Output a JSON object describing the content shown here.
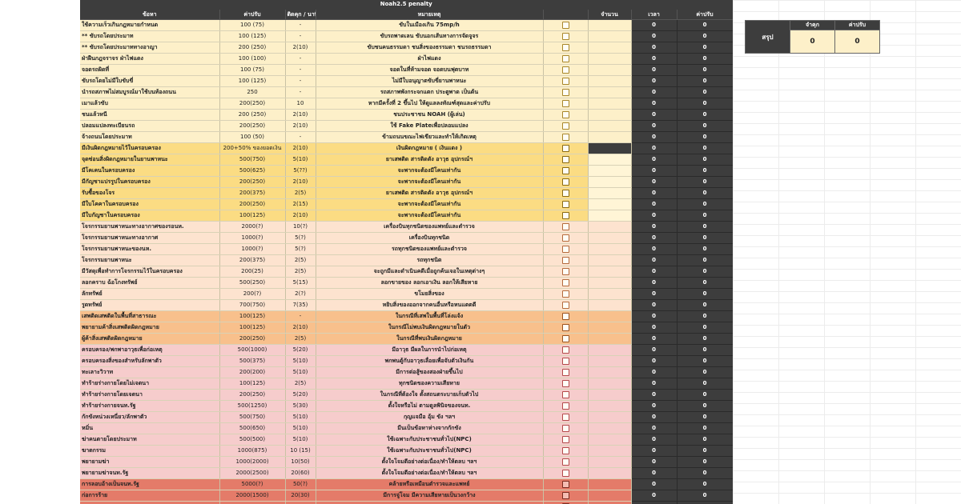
{
  "sheet_title": "Noah2.5 penalty",
  "headers": {
    "name": "ข้อหา",
    "fine": "ค่าปรับ",
    "jail": "ติดคุก / นาที",
    "note": "หมายเหตุ",
    "check": "",
    "count": "จำนวน",
    "time": "เวลา",
    "sum": "ค่าปรับ"
  },
  "rows": [
    {
      "g": "g1",
      "name": "ใช้ความเร็วเกินกฎหมายกำหนด",
      "fine": "100 (75)",
      "jail": "-",
      "note": "ขับในเมืองเกิน 75mp/h",
      "time": "0",
      "sum": "0"
    },
    {
      "g": "g1",
      "name": "** ขับรถโดยประมาท",
      "fine": "100 (125)",
      "jail": "-",
      "note": "ขับรถพาดเลน ขับนอกเส้นทางการจัดจูจร",
      "time": "0",
      "sum": "0"
    },
    {
      "g": "g1",
      "name": "** ขับรถโดยประมาททางอาญา",
      "fine": "200 (250)",
      "jail": "2(10)",
      "note": "ขับชนคนธรรมดา ชนสิ่งของธรรมดา ชนรถธรรมดา",
      "time": "0",
      "sum": "0"
    },
    {
      "g": "g1",
      "name": "ฝ่าฝืนกฎจราจร ฝ่าไฟแดง",
      "fine": "100 (100)",
      "jail": "-",
      "note": "ฝ่าไฟแดง",
      "time": "0",
      "sum": "0"
    },
    {
      "g": "g1",
      "name": "จอดรถผิดที่",
      "fine": "100 (75)",
      "jail": "-",
      "note": "จอดในที่ห้ามจอด จอดบนฟุตบาท",
      "time": "0",
      "sum": "0"
    },
    {
      "g": "g1",
      "name": "ขับรถโดยไม่มีใบขับขี่",
      "fine": "100 (125)",
      "jail": "-",
      "note": "ไม่มีใบอนุญาตขับขี่ยานพาหนะ",
      "time": "0",
      "sum": "0"
    },
    {
      "g": "g1",
      "name": "นำรถสภาพไม่สมบูรณ์มาใช้บนท้องถนน",
      "fine": "250",
      "jail": "-",
      "note": "รถสภาพพังกระจกแตก ประตูพาด เป็นต้น",
      "time": "0",
      "sum": "0"
    },
    {
      "g": "g1",
      "name": "เมาแล้วขับ",
      "fine": "200(250)",
      "jail": "10",
      "note": "หากมีครั้งที่ 2 ขึ้นไป ให้ดูแลลงทัณฑ์สุดและค่าปรับ",
      "time": "0",
      "sum": "0"
    },
    {
      "g": "g1",
      "name": "ชนแล้วหนี",
      "fine": "200 (250)",
      "jail": "2(10)",
      "note": "ชนประชาชน NOAH (ผู้เล่น)",
      "time": "0",
      "sum": "0"
    },
    {
      "g": "g1",
      "name": "ปลอมแปลงทะเบียนรถ",
      "fine": "200(250)",
      "jail": "2(10)",
      "note": "ใช้ Fake Plateเพื่อปลอมแปลง",
      "time": "0",
      "sum": "0"
    },
    {
      "g": "g1",
      "name": "จ้างถนนโดยประมาท",
      "fine": "100 (50)",
      "jail": "-",
      "note": "ข้ามถนนขณะไฟเขียวและทำให้เกิดเหตุ",
      "time": "0",
      "sum": "0"
    },
    {
      "g": "g2",
      "name": "มีเงินผิดกฎหมายไว้ในครอบครอง",
      "fine": "200+50% ของยอดเงิน",
      "jail": "2(10)",
      "note": "เงินผิดกฎหมาย ( เงินแดง )",
      "time": "0",
      "sum": "0",
      "dark": true
    },
    {
      "g": "g2",
      "name": "จุดซ่อนสิ่งผิดกฎหมายในยานพาหนะ",
      "fine": "500(750)",
      "jail": "5(10)",
      "note": "ยาเสพติด สารติดตัง อาวุธ อุปกรณ์ฯ",
      "time": "0",
      "sum": "0"
    },
    {
      "g": "g2",
      "name": "มีโคเคนในครอบครอง",
      "fine": "500(625)",
      "jail": "5(??)",
      "note": "จะพากจะต้องมีโคนเท่ากัน",
      "time": "0",
      "sum": "0"
    },
    {
      "g": "g2",
      "name": "มีกัญชาแปรรูปในครอบครอง",
      "fine": "200(250)",
      "jail": "2(10)",
      "note": "จะพากจะต้องมีโคนเท่ากัน",
      "time": "0",
      "sum": "0"
    },
    {
      "g": "g2",
      "name": "รับซื้อของโจร",
      "fine": "200(375)",
      "jail": "2(5)",
      "note": "ยาเสพติด สารติดตัง อาวุธ อุปกรณ์ฯ",
      "time": "0",
      "sum": "0"
    },
    {
      "g": "g2",
      "name": "มีใบโคคาในครอบครอง",
      "fine": "200(250)",
      "jail": "2(15)",
      "note": "จะพากจะต้องมีโคนเท่ากัน",
      "time": "0",
      "sum": "0"
    },
    {
      "g": "g2",
      "name": "มีใบกัญชาในครอบครอง",
      "fine": "100(125)",
      "jail": "2(10)",
      "note": "จะพากจะต้องมีโคนเท่ากัน",
      "time": "0",
      "sum": "0"
    },
    {
      "g": "g3",
      "name": "โจรกรรมยานพาหนะทางอากาศของรอนห.",
      "fine": "2000(?)",
      "jail": "10(?)",
      "note": "เครื่องบินทุกชนิดของแพทย์และตำรวจ",
      "time": "0",
      "sum": "0"
    },
    {
      "g": "g3",
      "name": "โจรกรรมยานพาหนะทางอากาศ",
      "fine": "1000(?)",
      "jail": "5(?)",
      "note": "เครื่องบินทุกชนิด",
      "time": "0",
      "sum": "0"
    },
    {
      "g": "g3",
      "name": "โจรกรรมยานพาหนะของนห.",
      "fine": "1000(?)",
      "jail": "5(?)",
      "note": "รถทุกชนิดของแพทย์และตำรวจ",
      "time": "0",
      "sum": "0"
    },
    {
      "g": "g3",
      "name": "โจรกรรมยานพาหนะ",
      "fine": "200(375)",
      "jail": "2(5)",
      "note": "รถทุกชนิด",
      "time": "0",
      "sum": "0"
    },
    {
      "g": "g3",
      "name": "มีวัสดุเพื่อทำการโจรกรรมไว้ในครอบครอง",
      "fine": "200(25)",
      "jail": "2(5)",
      "note": "จะถูกมีและดำเนินคดีเมื่อถูกค้นเจอในเหตุต่างๆ",
      "time": "0",
      "sum": "0"
    },
    {
      "g": "g3",
      "name": "ลอกคราบ ฉ้อโกงทรัพย์",
      "fine": "500(250)",
      "jail": "5(15)",
      "note": "ลอกขายของ ลอกเอาเงิน ลอกให้เสียหาย",
      "time": "0",
      "sum": "0"
    },
    {
      "g": "g3",
      "name": "ลักทรัพย์",
      "fine": "200(?)",
      "jail": "2(?)",
      "note": "ขโมยสิ่งของ",
      "time": "0",
      "sum": "0"
    },
    {
      "g": "g3",
      "name": "รูดทรัพย์",
      "fine": "700(750)",
      "jail": "7(35)",
      "note": "หยิบสิ่งของออกจากคนอื่นหรือหนแตตดี",
      "time": "0",
      "sum": "0"
    },
    {
      "g": "g4",
      "name": "เสพติดเสพติดในพื้นที่สาธารณะ",
      "fine": "100(125)",
      "jail": "-",
      "note": "ในกรณีที่เสพในพื้นที่โล่งแจ้ง",
      "time": "0",
      "sum": "0"
    },
    {
      "g": "g4",
      "name": "พยายามค้าสิ่งเสพติดผิดกฎหมาย",
      "fine": "100(125)",
      "jail": "2(10)",
      "note": "ในกรณีไม่พบเงินผิดกฎหมายในตัว",
      "time": "0",
      "sum": "0"
    },
    {
      "g": "g4",
      "name": "ผู้ค้าสิ่งเสพติดผิดกฎหมาย",
      "fine": "200(250)",
      "jail": "2(5)",
      "note": "ในกรณีที่พบเงินผิดกฎหมาย",
      "time": "0",
      "sum": "0"
    },
    {
      "g": "g5",
      "name": "ครอบครอง/พกพาอาวุธเพื่อก่อเหตุ",
      "fine": "500(1000)",
      "jail": "5(20)",
      "note": "มีอาวุธ มีผลในการนำไปก่อเหตุ",
      "time": "0",
      "sum": "0"
    },
    {
      "g": "g5",
      "name": "ครอบครองสิ่งของสำหรับลักพาตัว",
      "fine": "500(375)",
      "jail": "5(10)",
      "note": "พกพนตู้กับอาวุธเลื่อยเพื่อจับตัวเงินกัน",
      "time": "0",
      "sum": "0"
    },
    {
      "g": "g5",
      "name": "ทะเลาะวิวาท",
      "fine": "200(200)",
      "jail": "5(10)",
      "note": "มีการต่อสู้ของสองฝ่ายขึ้นไป",
      "time": "0",
      "sum": "0"
    },
    {
      "g": "g5",
      "name": "ทำร้ายร่างกายโดยไม่เจตนา",
      "fine": "100(125)",
      "jail": "2(5)",
      "note": "ทุกชนิดของความเสียหาย",
      "time": "0",
      "sum": "0"
    },
    {
      "g": "g5",
      "name": "ทำร้ายร่างกายโดยเจตนา",
      "fine": "200(250)",
      "jail": "5(20)",
      "note": "ในกรณีที่ต้องใจ ตั้งสถนตระบายเก็บตัวไป",
      "time": "0",
      "sum": "0"
    },
    {
      "g": "g5",
      "name": "ทำร้ายร่างกายจนท.รัฐ",
      "fine": "500(1250)",
      "jail": "5(30)",
      "note": "ตั้งใจหรือไม่ ตามดูลพินิจของจนท.",
      "time": "0",
      "sum": "0"
    },
    {
      "g": "g5",
      "name": "กักขังหน่วงเหนี่ยว/ลักพาตัว",
      "fine": "500(750)",
      "jail": "5(10)",
      "note": "กุญแจมือ อุ้ม ขัง ฯลฯ",
      "time": "0",
      "sum": "0"
    },
    {
      "g": "g5",
      "name": "หมิ่น",
      "fine": "500(650)",
      "jail": "5(10)",
      "note": "มีนเป็นข้อหาห่างจากกักขัง",
      "time": "0",
      "sum": "0"
    },
    {
      "g": "g5",
      "name": "ฆ่าคนตายโดยประมาท",
      "fine": "500(500)",
      "jail": "5(10)",
      "note": "ใช้เฉพาะกับประชาชนทั่วไป(NPC)",
      "time": "0",
      "sum": "0"
    },
    {
      "g": "g5",
      "name": "ฆาตกรรม",
      "fine": "1000(875)",
      "jail": "10 (15)",
      "note": "ใช้เฉพาะกับประชาชนทั่วไป(NPC)",
      "time": "0",
      "sum": "0"
    },
    {
      "g": "g5",
      "name": "พยายามฆ่า",
      "fine": "1000(2000)",
      "jail": "10(50)",
      "note": "ตั้งใจโจมตีอย่างต่อเนื่อง/ทำให้ตลบ ฯลฯ",
      "time": "0",
      "sum": "0"
    },
    {
      "g": "g5",
      "name": "พยายามฆ่าจนท.รัฐ",
      "fine": "2000(2500)",
      "jail": "20(60)",
      "note": "ตั้งใจโจมตีอย่างต่อเนื่อง/ทำให้ตลบ ฯลฯ",
      "time": "0",
      "sum": "0"
    },
    {
      "g": "g6",
      "name": "การลอบอ้างเป็นจนท.รัฐ",
      "fine": "5000(?)",
      "jail": "50(?)",
      "note": "คล้ายหรือเหมือนตำรวจและแพทย์",
      "time": "0",
      "sum": "0"
    },
    {
      "g": "g6",
      "name": "ก่อการร้าย",
      "fine": "2000(1500)",
      "jail": "20(30)",
      "note": "มีการจู่โจม มีความเสียหายเป็นวงกว้าง",
      "time": "0",
      "sum": "0"
    },
    {
      "g": "g6",
      "name": "",
      "fine": "",
      "jail": "",
      "note": "",
      "time": "0",
      "sum": "0"
    }
  ],
  "summary": {
    "label": "สรุป",
    "col1_head": "จำคุก",
    "col2_head": "ค่าปรับ",
    "col1_val": "0",
    "col2_val": "0"
  }
}
